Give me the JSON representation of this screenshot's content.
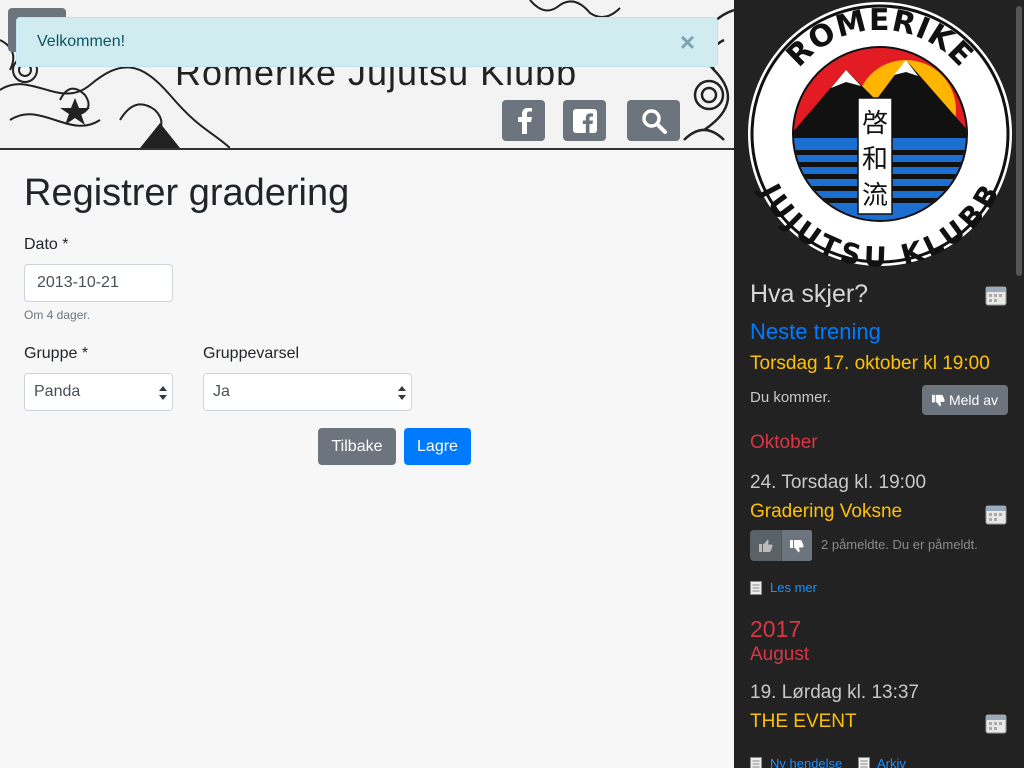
{
  "header": {
    "site_title": "Romerike Jujutsu Klubb",
    "icons": [
      "facebook-icon",
      "facebook-square-icon",
      "search-icon"
    ]
  },
  "alert": {
    "text": "Velkommen!",
    "close": "×"
  },
  "form": {
    "title": "Registrer gradering",
    "date_label": "Dato *",
    "date_value": "2013-10-21",
    "date_help": "Om 4 dager.",
    "group_label": "Gruppe *",
    "group_value": "Panda",
    "notify_label": "Gruppevarsel",
    "notify_value": "Ja",
    "back_label": "Tilbake",
    "save_label": "Lagre"
  },
  "sidebar": {
    "logo": {
      "top_text": "ROMERIKE",
      "bottom_text": "JUJUTSU KLUBB",
      "kanji": [
        "啓",
        "和",
        "流"
      ]
    },
    "heading": "Hva skjer?",
    "next_training_label": "Neste trening",
    "next_training_time": "Torsdag 17. oktober kl 19:00",
    "attending_text": "Du kommer.",
    "unregister_label": "Meld av",
    "month1": "Oktober",
    "event1_date": "24. Torsdag kl. 19:00",
    "event1_title": "Gradering Voksne",
    "event1_status": "2 påmeldte. Du er påmeldt.",
    "read_more": "Les mer",
    "year2": "2017",
    "month2": "August",
    "event2_date": "19. Lørdag kl. 13:37",
    "event2_title": "THE EVENT",
    "new_event": "Ny hendelse",
    "archive": "Arkiv"
  },
  "colors": {
    "accent_blue": "#007bff",
    "yellow": "#ffc107",
    "red": "#dc3545",
    "sidebar_bg": "#222222",
    "alert_bg": "#d1ecf1"
  }
}
